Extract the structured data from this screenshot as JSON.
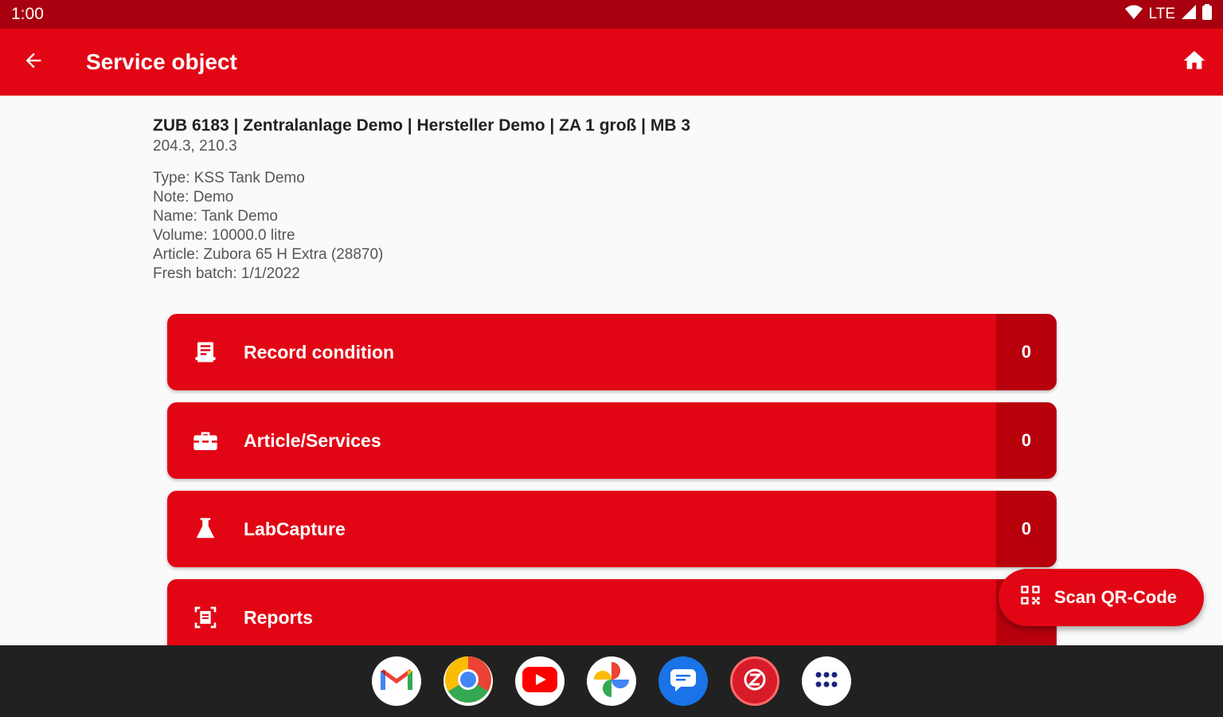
{
  "status_bar": {
    "time": "1:00",
    "network": "LTE"
  },
  "app_bar": {
    "title": "Service object"
  },
  "info": {
    "title": "ZUB 6183 | Zentralanlage Demo | Hersteller Demo | ZA 1 groß | MB 3",
    "subtitle": "204.3, 210.3",
    "details": [
      "Type: KSS Tank Demo",
      "Note: Demo",
      "Name: Tank Demo",
      "Volume: 10000.0 litre",
      "Article: Zubora 65 H Extra (28870)",
      "Fresh batch: 1/1/2022"
    ]
  },
  "menu": [
    {
      "label": "Record condition",
      "count": "0",
      "icon": "clipboard-icon"
    },
    {
      "label": "Article/Services",
      "count": "0",
      "icon": "toolbox-icon"
    },
    {
      "label": "LabCapture",
      "count": "0",
      "icon": "flask-icon"
    },
    {
      "label": "Reports",
      "count": "",
      "icon": "document-scan-icon"
    }
  ],
  "fab": {
    "label": "Scan QR-Code"
  },
  "colors": {
    "primary": "#e20615",
    "primary_dark": "#a8000e",
    "count_bg": "#b8000c",
    "taskbar": "#212121"
  },
  "dock": [
    "gmail-icon",
    "chrome-icon",
    "youtube-icon",
    "photos-icon",
    "messages-icon",
    "red-app-icon",
    "app-drawer-icon"
  ]
}
